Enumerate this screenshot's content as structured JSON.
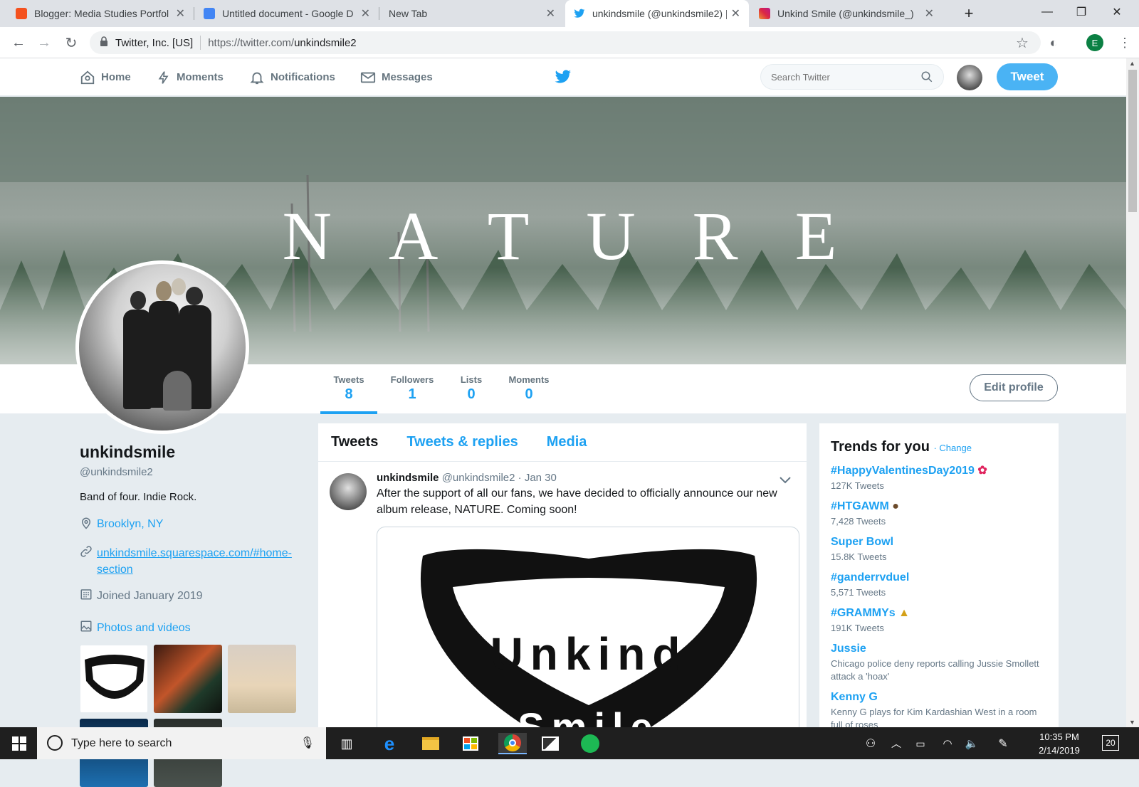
{
  "browser": {
    "tabs": [
      {
        "title": "Blogger: Media Studies Portfol",
        "favicon_color": "#f4511e"
      },
      {
        "title": "Untitled document - Google D",
        "favicon_color": "#4285f4"
      },
      {
        "title": "New Tab",
        "favicon_color": ""
      },
      {
        "title": "unkindsmile (@unkindsmile2) |",
        "favicon_color": "#1da1f2"
      },
      {
        "title": "Unkind Smile (@unkindsmile_)",
        "favicon_color": "#c13584"
      }
    ],
    "new_tab": "+",
    "site_identity": "Twitter, Inc. [US]",
    "url_host": "https://twitter.com/",
    "url_path": "unkindsmile2",
    "profile_initial": "E"
  },
  "twitter_nav": {
    "home": "Home",
    "moments": "Moments",
    "notifications": "Notifications",
    "messages": "Messages",
    "search_placeholder": "Search Twitter",
    "tweet_button": "Tweet"
  },
  "banner": {
    "word": "NATURE"
  },
  "profile": {
    "name": "unkindsmile",
    "handle": "@unkindsmile2",
    "bio": "Band of four. Indie Rock.",
    "location": "Brooklyn, NY",
    "website": "unkindsmile.squarespace.com/#home-section",
    "joined": "Joined January 2019",
    "photos_label": "Photos and videos",
    "edit_button": "Edit profile"
  },
  "stats": [
    {
      "label": "Tweets",
      "value": "8"
    },
    {
      "label": "Followers",
      "value": "1"
    },
    {
      "label": "Lists",
      "value": "0"
    },
    {
      "label": "Moments",
      "value": "0"
    }
  ],
  "timeline": {
    "tabs": [
      "Tweets",
      "Tweets & replies",
      "Media"
    ],
    "tweet": {
      "name": "unkindsmile",
      "handle": "@unkindsmile2",
      "date": "· Jan 30",
      "text": "After the support of all our fans, we have decided to officially announce our new album release, NATURE. Coming soon!",
      "media_word_top": "Unkind",
      "media_word_bottom": "Smile"
    }
  },
  "trends": {
    "title": "Trends for you",
    "change": "· Change",
    "items": [
      {
        "tag": "#HappyValentinesDay2019",
        "sub": "127K Tweets"
      },
      {
        "tag": "#HTGAWM",
        "sub": "7,428 Tweets"
      },
      {
        "tag": "Super Bowl",
        "sub": "15.8K Tweets"
      },
      {
        "tag": "#ganderrvduel",
        "sub": "5,571 Tweets"
      },
      {
        "tag": "#GRAMMYs",
        "sub": "191K Tweets"
      },
      {
        "tag": "Jussie",
        "sub": "Chicago police deny reports calling Jussie Smollett attack a 'hoax'"
      },
      {
        "tag": "Kenny G",
        "sub": "Kenny G plays for Kim Kardashian West in a room full of roses"
      }
    ]
  },
  "taskbar": {
    "search_placeholder": "Type here to search",
    "time": "10:35 PM",
    "date": "2/14/2019",
    "notifications_count": "20"
  },
  "colors": {
    "twitter_blue": "#1da1f2",
    "tweet_button": "#4ab3f4"
  }
}
